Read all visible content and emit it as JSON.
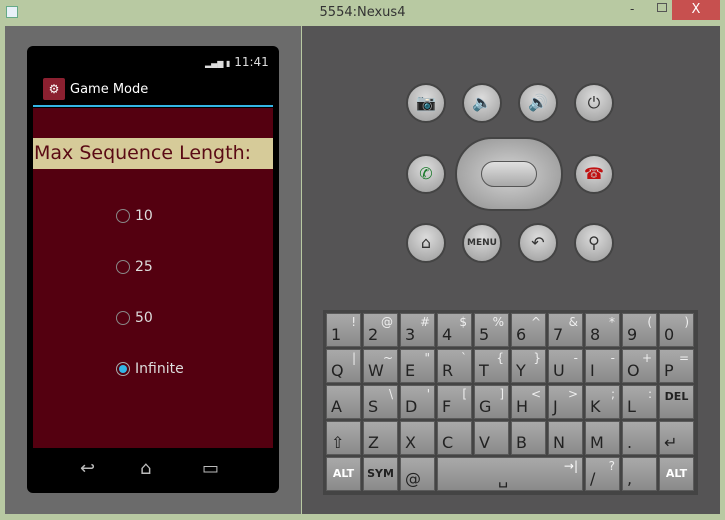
{
  "window": {
    "title": "5554:Nexus4",
    "close": "X",
    "minimize": "-"
  },
  "status": {
    "time": "11:41",
    "signal": "3G"
  },
  "app": {
    "title": "Game Mode",
    "heading": "Max Sequence Length:",
    "options": [
      {
        "label": "10",
        "selected": false
      },
      {
        "label": "25",
        "selected": false
      },
      {
        "label": "50",
        "selected": false
      },
      {
        "label": "Infinite",
        "selected": true
      }
    ]
  },
  "controls": {
    "menu": "MENU"
  },
  "keyboard": {
    "rows": [
      [
        [
          "1",
          "!"
        ],
        [
          "2",
          "@"
        ],
        [
          "3",
          "#"
        ],
        [
          "4",
          "$"
        ],
        [
          "5",
          "%"
        ],
        [
          "6",
          "^"
        ],
        [
          "7",
          "&"
        ],
        [
          "8",
          "*"
        ],
        [
          "9",
          "("
        ],
        [
          "0",
          ")"
        ]
      ],
      [
        [
          "Q",
          "|"
        ],
        [
          "W",
          "~"
        ],
        [
          "E",
          "\""
        ],
        [
          "R",
          "`"
        ],
        [
          "T",
          "{"
        ],
        [
          "Y",
          "}"
        ],
        [
          "U",
          "-"
        ],
        [
          "I",
          "-"
        ],
        [
          "O",
          "+"
        ],
        [
          "P",
          "="
        ]
      ],
      [
        [
          "A",
          ""
        ],
        [
          "S",
          "\\"
        ],
        [
          "D",
          "'"
        ],
        [
          "F",
          "["
        ],
        [
          "G",
          "]"
        ],
        [
          "H",
          "<"
        ],
        [
          "J",
          ">"
        ],
        [
          "K",
          ";"
        ],
        [
          "L",
          ":"
        ],
        [
          "DEL",
          ""
        ]
      ],
      [
        [
          "⇧",
          ""
        ],
        [
          "Z",
          ""
        ],
        [
          "X",
          ""
        ],
        [
          "C",
          ""
        ],
        [
          "V",
          ""
        ],
        [
          "B",
          ""
        ],
        [
          "N",
          ""
        ],
        [
          "M",
          ""
        ],
        [
          ".",
          ""
        ],
        [
          "↵",
          ""
        ]
      ]
    ],
    "bottom": {
      "alt": "ALT",
      "sym": "SYM",
      "at": "@",
      "space": "␣",
      "tab": "→|",
      "slash": "/",
      "question": "?",
      "comma": ","
    }
  }
}
